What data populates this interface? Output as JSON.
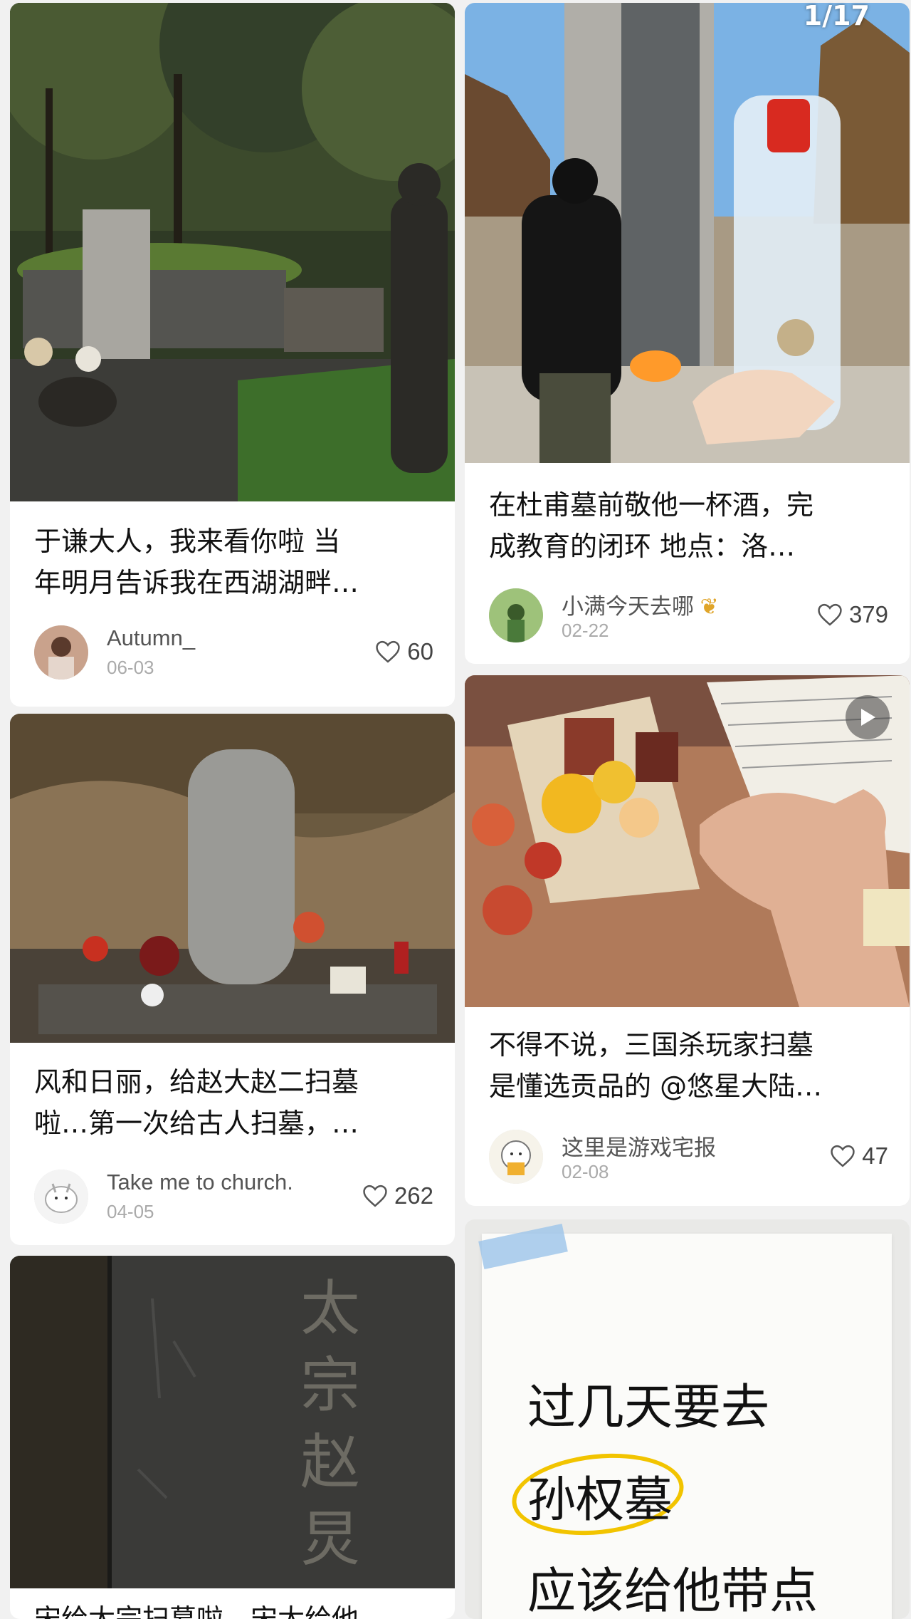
{
  "page_counter": "1/17",
  "cards": {
    "c1": {
      "title_l1": "于谦大人，我来看你啦 当",
      "title_l2": "年明月告诉我在西湖湖畔…",
      "user": "Autumn_",
      "date": "06-03",
      "likes": "60"
    },
    "c2": {
      "title_l1": "在杜甫墓前敬他一杯酒，完",
      "title_l2": "成教育的闭环 地点：洛…",
      "user": "小满今天去哪",
      "date": "02-22",
      "likes": "379"
    },
    "c3": {
      "title_l1": "风和日丽，给赵大赵二扫墓",
      "title_l2": "啦…第一次给古人扫墓，…",
      "user": "Take me to church.",
      "date": "04-05",
      "likes": "262"
    },
    "c4": {
      "title_l1": "不得不说，三国杀玩家扫墓",
      "title_l2": "是懂选贡品的 @悠星大陆…",
      "user": "这里是游戏宅报",
      "date": "02-08",
      "likes": "47"
    },
    "c5": {
      "title_l1": "宋给太宗扫墓啦，宋太给他",
      "image_text": "太宗赵炅"
    },
    "c6": {
      "note_l1": "过几天要去",
      "note_l2": "孙权墓",
      "note_l3": "应该给他带点"
    }
  },
  "icons": {
    "heart": "heart-outline-icon",
    "play": "play-icon"
  }
}
